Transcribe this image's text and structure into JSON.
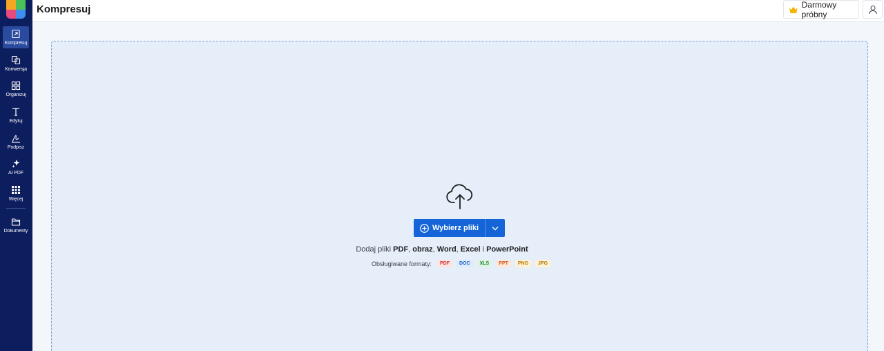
{
  "app": {
    "title": "Kompresuj"
  },
  "sidebar": {
    "items": [
      {
        "label": "Kompresuj",
        "icon": "compress-icon",
        "active": true
      },
      {
        "label": "Konwersja",
        "icon": "convert-icon",
        "active": false
      },
      {
        "label": "Organizuj",
        "icon": "organize-icon",
        "active": false
      },
      {
        "label": "Edytuj",
        "icon": "edit-text-icon",
        "active": false
      },
      {
        "label": "Podpisz",
        "icon": "sign-icon",
        "active": false
      },
      {
        "label": "AI PDF",
        "icon": "ai-sparkle-icon",
        "active": false
      },
      {
        "label": "Więcej",
        "icon": "grid-more-icon",
        "active": false
      },
      {
        "label": "Dokumenty",
        "icon": "folder-icon",
        "active": false
      }
    ]
  },
  "header": {
    "trial_label": "Darmowy próbny",
    "trial_icon": "crown-icon",
    "user_icon": "user-icon"
  },
  "upload": {
    "icon": "cloud-upload-icon",
    "button_label": "Wybierz pliki",
    "hint": {
      "prefix": "Dodaj pliki ",
      "pdf": "PDF",
      "sep1": ", ",
      "image": "obraz",
      "sep2": ", ",
      "word": "Word",
      "sep3": ", ",
      "excel": "Excel",
      "conj": " i ",
      "ppt": "PowerPoint"
    },
    "formats_label": "Obsługiwane formaty:",
    "formats": [
      "PDF",
      "DOC",
      "XLS",
      "PPT",
      "PNG",
      "JPG"
    ]
  },
  "colors": {
    "sidebar": "#0d1e5e",
    "accent": "#1565d8",
    "dropzone": "#e6eef9"
  }
}
